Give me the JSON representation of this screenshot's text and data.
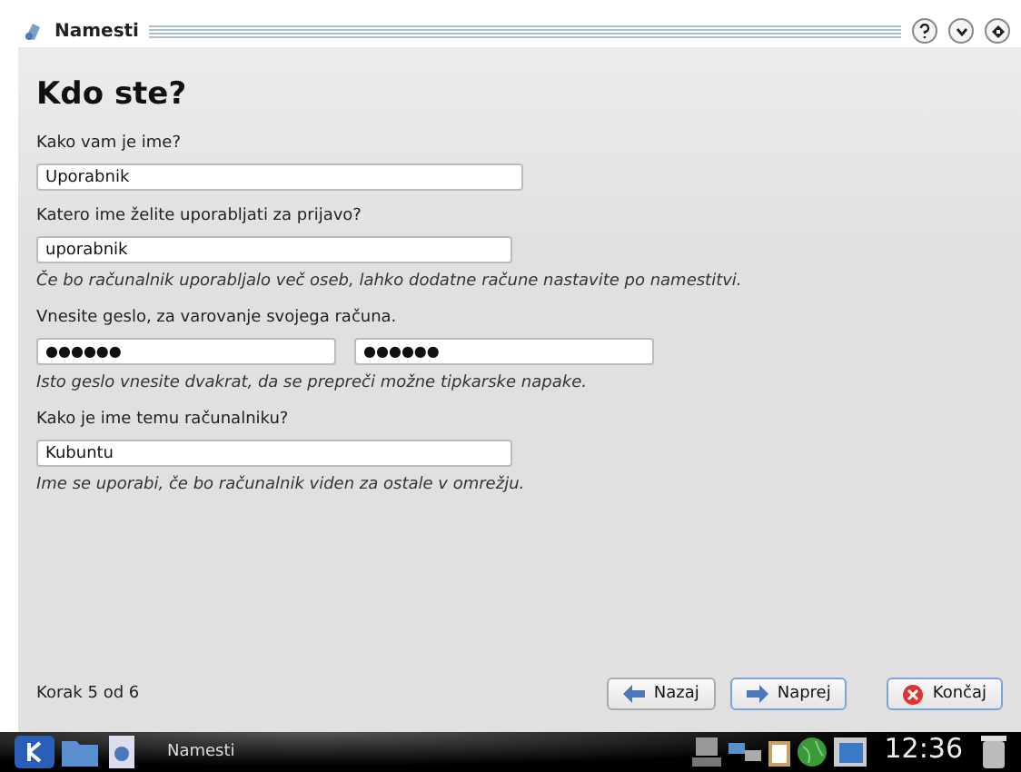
{
  "window": {
    "title": "Namesti"
  },
  "heading": "Kdo ste?",
  "sections": [
    {
      "label": "Kako vam je ime?",
      "fields": [
        {
          "value": "Uporabnik",
          "kind": "text"
        }
      ]
    },
    {
      "label": "Katero ime želite uporabljati za prijavo?",
      "fields": [
        {
          "value": "uporabnik",
          "kind": "text"
        }
      ],
      "hint": "Če bo računalnik uporabljalo več oseb, lahko dodatne račune nastavite po namestitvi."
    },
    {
      "label": "Vnesite geslo, za varovanje svojega računa.",
      "fields": [
        {
          "value": "●●●●●●",
          "kind": "password"
        },
        {
          "value": "●●●●●●",
          "kind": "password"
        }
      ],
      "hint": "Isto geslo vnesite dvakrat, da se prepreči možne tipkarske napake."
    },
    {
      "label": "Kako je ime temu računalniku?",
      "fields": [
        {
          "value": "Kubuntu",
          "kind": "text"
        }
      ],
      "hint": "Ime se uporabi, če bo računalnik viden za ostale v omrežju."
    }
  ],
  "step": "Korak 5 od 6",
  "buttons": [
    {
      "label": "Nazaj",
      "kind": "back",
      "focused": false
    },
    {
      "label": "Naprej",
      "kind": "next",
      "focused": true
    },
    {
      "label": "Končaj",
      "kind": "cancel",
      "focused": true
    }
  ],
  "taskbar": {
    "task": "Namesti",
    "time": "12:36"
  }
}
